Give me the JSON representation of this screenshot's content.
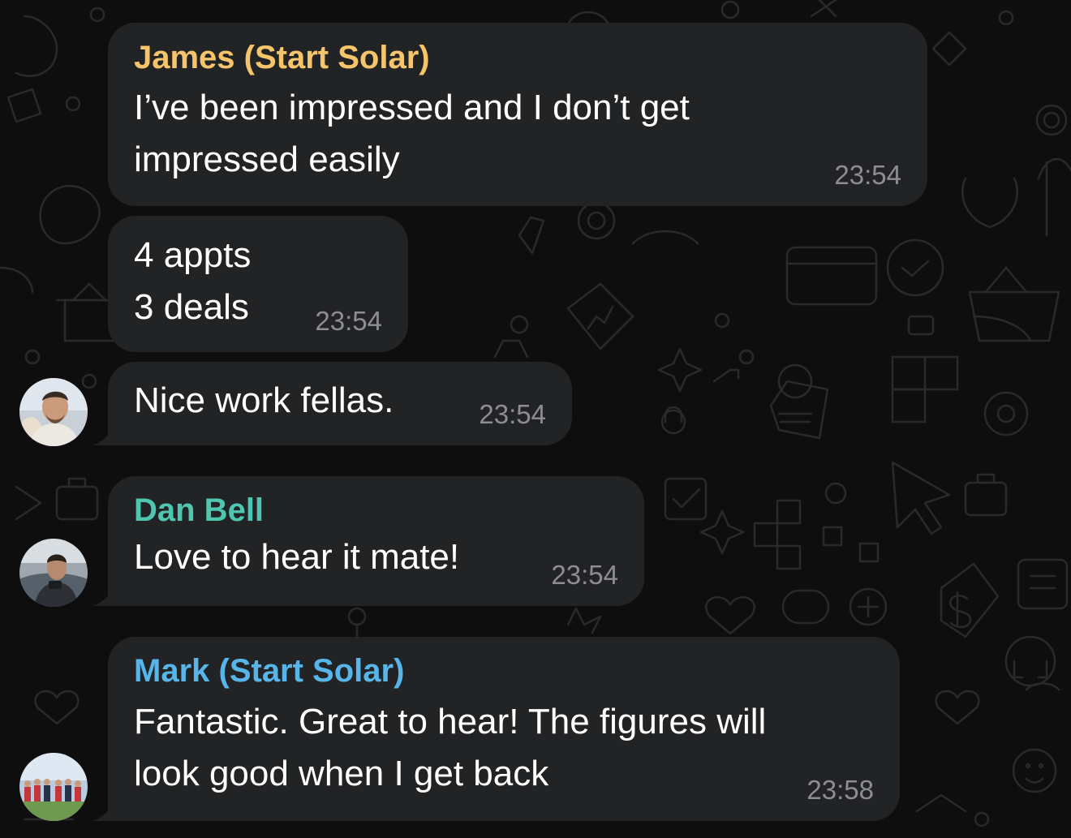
{
  "colors": {
    "background": "#0e0e0f",
    "bubble": "#222325",
    "text": "#ffffff",
    "timestamp": "#8d8e92",
    "sender_james": "#f6c56b",
    "sender_dan": "#4fc7b0",
    "sender_mark": "#58b5ea"
  },
  "messages": [
    {
      "sender": "James (Start Solar)",
      "text": "I’ve been impressed and I don’t get\nimpressed easily",
      "time": "23:54"
    },
    {
      "text": "4 appts\n3 deals",
      "time": "23:54"
    },
    {
      "text": "Nice work fellas.",
      "time": "23:54"
    },
    {
      "sender": "Dan Bell",
      "text": "Love to hear it mate!",
      "time": "23:54"
    },
    {
      "sender": "Mark (Start Solar)",
      "text": "Fantastic. Great to hear! The figures will\nlook good when I get back",
      "time": "23:58"
    }
  ]
}
